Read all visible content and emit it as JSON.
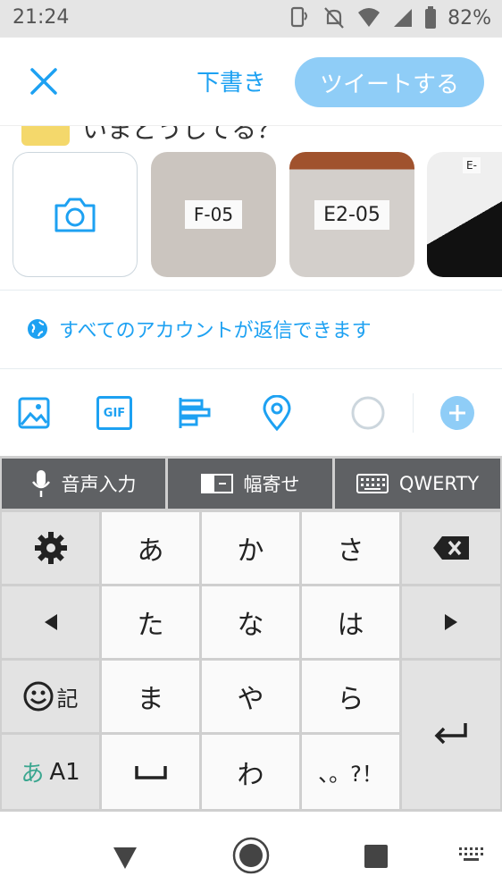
{
  "status": {
    "time": "21:24",
    "battery": "82%"
  },
  "header": {
    "draft_label": "下書き",
    "tweet_label": "ツイートする"
  },
  "compose": {
    "peek_text": "いまどうしてる？"
  },
  "media": {
    "photos": [
      {
        "label": "F-05",
        "bg": "#c9c2bd"
      },
      {
        "label": "E2-05",
        "bg": "#d0ccc8"
      },
      {
        "label": "E-",
        "bg": "#1a1a1a"
      }
    ]
  },
  "reply_setting": {
    "text": "すべてのアカウントが返信できます"
  },
  "toolbar": {
    "gif_label": "GIF"
  },
  "keyboard": {
    "top": {
      "voice": "音声入力",
      "width": "幅寄せ",
      "qwerty": "QWERTY"
    },
    "keys": {
      "a": "あ",
      "ka": "か",
      "sa": "さ",
      "ta": "た",
      "na": "な",
      "ha": "は",
      "ma": "ま",
      "ya": "や",
      "ra": "ら",
      "wa": "わ",
      "punct": "、。?！",
      "kigou": "記",
      "mode_a": "あ",
      "mode_a1": "A1"
    }
  },
  "colors": {
    "accent": "#1da1f2",
    "tweet_button": "#8fcdf7"
  }
}
